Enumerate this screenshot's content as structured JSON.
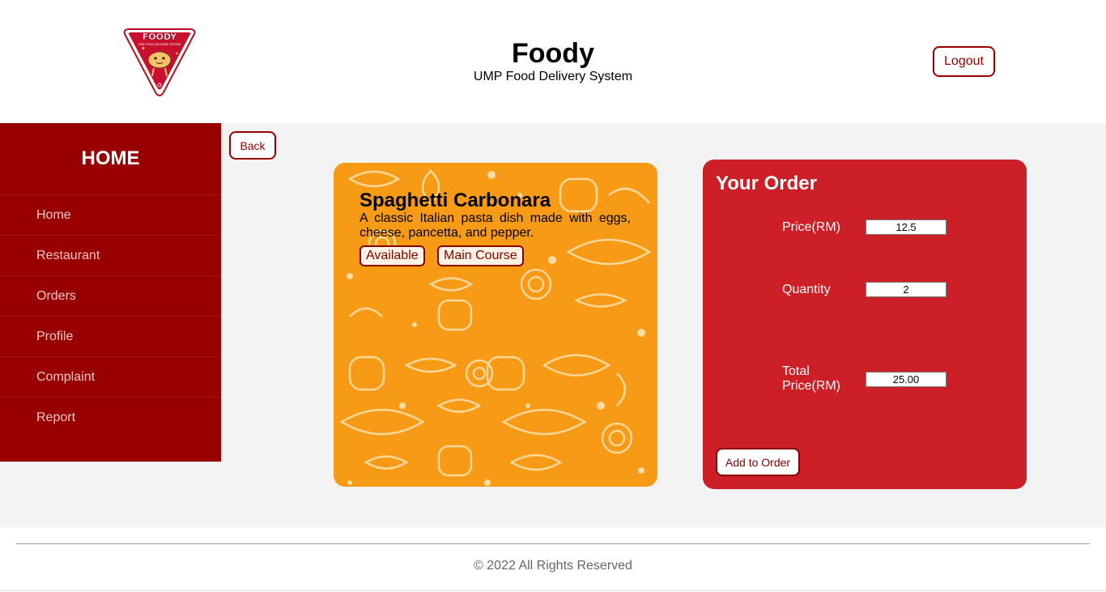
{
  "header": {
    "logo_text": "FOODY",
    "logo_subtext": "UMP FOOD DELIVERY SYSTEM",
    "title": "Foody",
    "subtitle": "UMP Food Delivery System",
    "logout_label": "Logout"
  },
  "sidebar": {
    "title": "HOME",
    "items": [
      {
        "label": "Home"
      },
      {
        "label": "Restaurant"
      },
      {
        "label": "Orders"
      },
      {
        "label": "Profile"
      },
      {
        "label": "Complaint"
      },
      {
        "label": "Report"
      }
    ]
  },
  "back_label": "Back",
  "food": {
    "name": "Spaghetti Carbonara",
    "description": "A classic Italian pasta dish made with eggs, cheese, pancetta, and pepper.",
    "availability": "Available",
    "category": "Main Course"
  },
  "order": {
    "title": "Your Order",
    "price_label": "Price(RM)",
    "price_value": "12.5",
    "quantity_label": "Quantity",
    "quantity_value": "2",
    "total_label_line1": "Total",
    "total_label_line2": "Price(RM)",
    "total_value": "25.00",
    "add_label": "Add to Order"
  },
  "footer": {
    "copyright": "© 2022 All Rights Reserved"
  },
  "colors": {
    "brand": "#990000",
    "order_panel": "#cc1f28",
    "card": "#f79a16"
  }
}
